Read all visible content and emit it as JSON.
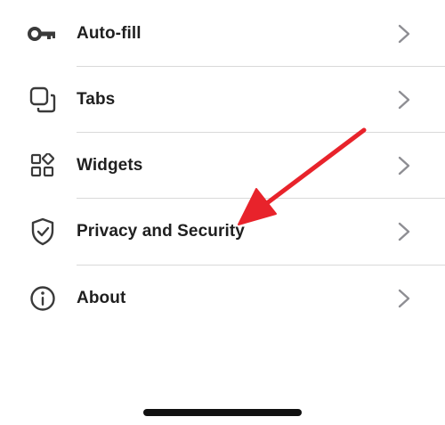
{
  "settings": {
    "items": [
      {
        "label": "Auto-fill",
        "icon": "key-icon"
      },
      {
        "label": "Tabs",
        "icon": "tabs-icon"
      },
      {
        "label": "Widgets",
        "icon": "widgets-icon"
      },
      {
        "label": "Privacy and Security",
        "icon": "shield-check-icon"
      },
      {
        "label": "About",
        "icon": "info-icon"
      }
    ]
  },
  "annotation": {
    "arrow_color": "#e8232b",
    "target": "Privacy and Security"
  },
  "colors": {
    "label": "#1f1f1f",
    "icon": "#3a3a3a",
    "chevron": "#8e8e93",
    "divider": "#d9d9d9",
    "background": "#ffffff"
  }
}
